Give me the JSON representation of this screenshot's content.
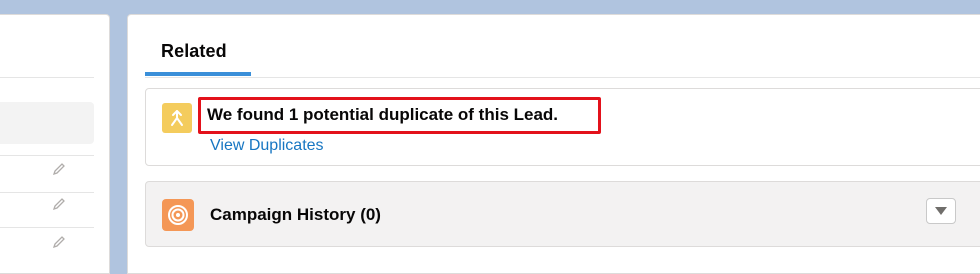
{
  "tabs": {
    "related_label": "Related"
  },
  "duplicate_alert": {
    "message": "We found 1 potential duplicate of this Lead.",
    "link_label": "View Duplicates",
    "icon": "duplicate-merge-icon",
    "icon_color": "#f4cc5d",
    "highlight_color": "#e3111b"
  },
  "campaign_history": {
    "title": "Campaign History (0)",
    "icon": "target-icon",
    "icon_color": "#f49756",
    "menu_icon": "chevron-down-icon"
  },
  "colors": {
    "accent": "#3a8fd9",
    "link": "#1776c2",
    "background": "#b0c4df"
  }
}
